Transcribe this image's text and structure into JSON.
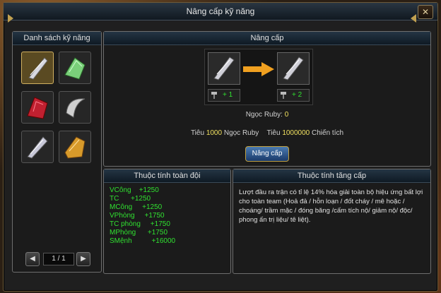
{
  "window": {
    "title": "Nâng cấp kỹ năng",
    "close_label": "✕"
  },
  "skill_list": {
    "header": "Danh sách kỹ năng",
    "items": [
      {
        "icon": "silver-claw-icon",
        "selected": true
      },
      {
        "icon": "green-crystal-claw-icon",
        "selected": false
      },
      {
        "icon": "red-crystal-icon",
        "selected": false
      },
      {
        "icon": "silver-hook-claw-icon",
        "selected": false
      },
      {
        "icon": "silver-blade-icon",
        "selected": false
      },
      {
        "icon": "gold-scroll-icon",
        "selected": false
      }
    ],
    "pager": {
      "prev": "◀",
      "next": "▶",
      "text": "1 / 1"
    }
  },
  "upgrade": {
    "header": "Nâng cấp",
    "from_level": "+ 1",
    "to_level": "+ 2",
    "ruby_label": "Ngọc Ruby: ",
    "ruby_value": "0",
    "cost_prefix_1": "Tiêu ",
    "cost_ruby_value": "1000",
    "cost_ruby_unit": " Ngọc Ruby",
    "cost_prefix_2": "Tiêu ",
    "cost_merit_value": "1000000",
    "cost_merit_unit": " Chiến tích",
    "button_label": "Nâng cấp"
  },
  "team_attrs": {
    "header": "Thuộc tính toàn đội",
    "rows": [
      "VCông    +1250",
      "TC      +1250",
      "MCông     +1250",
      "VPhòng     +1750",
      "TC phòng     +1750",
      "MPhòng      +1750",
      "SMệnh          +16000"
    ]
  },
  "level_attrs": {
    "header": "Thuộc tính tăng cấp",
    "description": "Lượt đầu ra trận có tỉ lệ 14% hóa giải toàn bộ hiệu ứng bất lợi cho toàn team (Hoả đả / hỗn loạn / đốt cháy / mê hoặc / choáng/ trầm mặc / đóng băng /cấm tích nộ/ giảm nộ/ độc/ phong ấn trị liệu/ tê liệt)."
  },
  "colors": {
    "green_stat": "#30e030",
    "yellow_value": "#f0e060",
    "header_bg": "#243544"
  }
}
